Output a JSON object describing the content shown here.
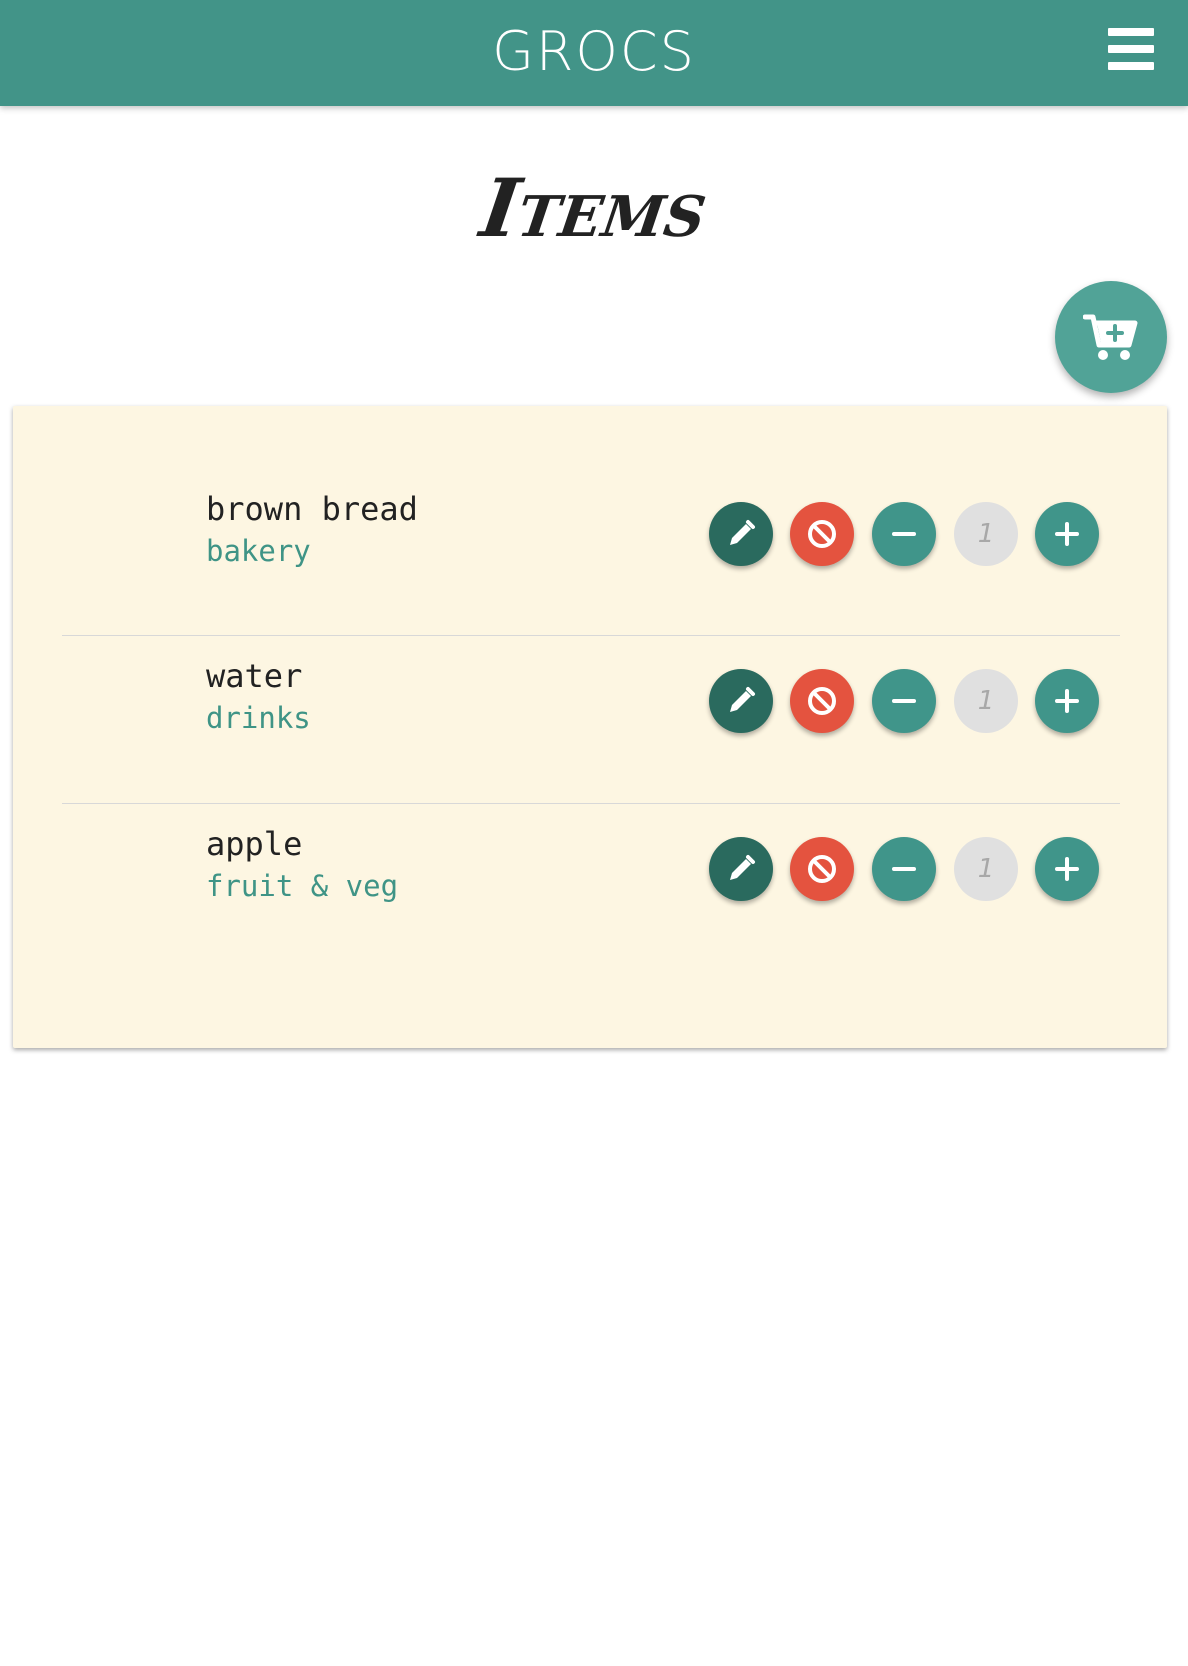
{
  "header": {
    "title": "GROCS",
    "menu_icon": "hamburger-menu-icon"
  },
  "page": {
    "title": "Items"
  },
  "fab": {
    "icon": "cart-plus-icon"
  },
  "colors": {
    "primary": "#429488",
    "edit": "#2a6a5e",
    "delete": "#e4533f",
    "card": "#fdf6e2",
    "category_text": "#3f9486"
  },
  "items": [
    {
      "name": "brown bread",
      "category": "bakery",
      "quantity": "1"
    },
    {
      "name": "water",
      "category": "drinks",
      "quantity": "1"
    },
    {
      "name": "apple",
      "category": "fruit & veg",
      "quantity": "1"
    }
  ]
}
